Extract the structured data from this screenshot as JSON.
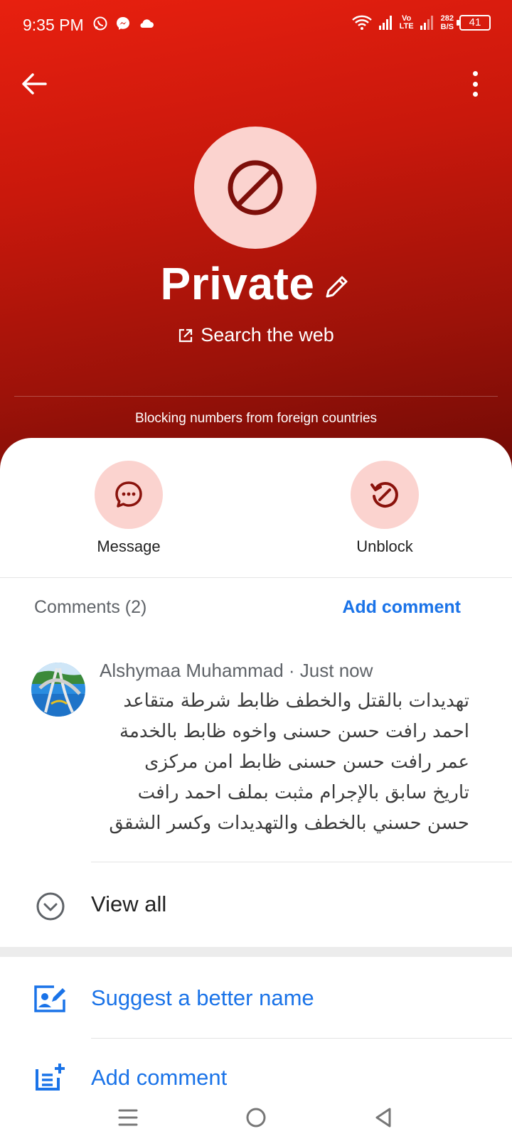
{
  "status_bar": {
    "time": "9:35 PM",
    "lte_top": "Vo",
    "lte_bottom": "LTE",
    "speed_value": "282",
    "speed_unit": "B/S",
    "battery": "41",
    "icons": [
      "whatsapp-icon",
      "messenger-icon",
      "cloud-icon",
      "wifi-icon",
      "signal-icon",
      "signal-icon",
      "battery-icon"
    ]
  },
  "header": {
    "name": "Private",
    "search_web": "Search the web",
    "blocking_note": "Blocking numbers from foreign countries",
    "color_top": "#e8200f",
    "color_bottom": "#6e0a05"
  },
  "actions": {
    "message": "Message",
    "unblock": "Unblock",
    "circle_color": "#fbd3cf",
    "icon_color": "#8a120c"
  },
  "comments": {
    "title": "Comments (2)",
    "add_link": "Add comment",
    "items": [
      {
        "author": "Alshymaa Muhammad",
        "time": "Just now",
        "text": "تهديدات بالقتل والخطف ظابط شرطة متقاعد\nاحمد رافت حسن حسنى واخوه ظابط بالخدمة\nعمر رافت حسن حسنى ظابط امن مركزى\nتاريخ سابق بالإجرام مثبت بملف احمد رافت\nحسن حسني بالخطف والتهديدات وكسر الشقق"
      }
    ],
    "view_all": "View all"
  },
  "menu": {
    "suggest_name": "Suggest a better name",
    "add_comment": "Add comment",
    "link_color": "#1a73e8"
  }
}
